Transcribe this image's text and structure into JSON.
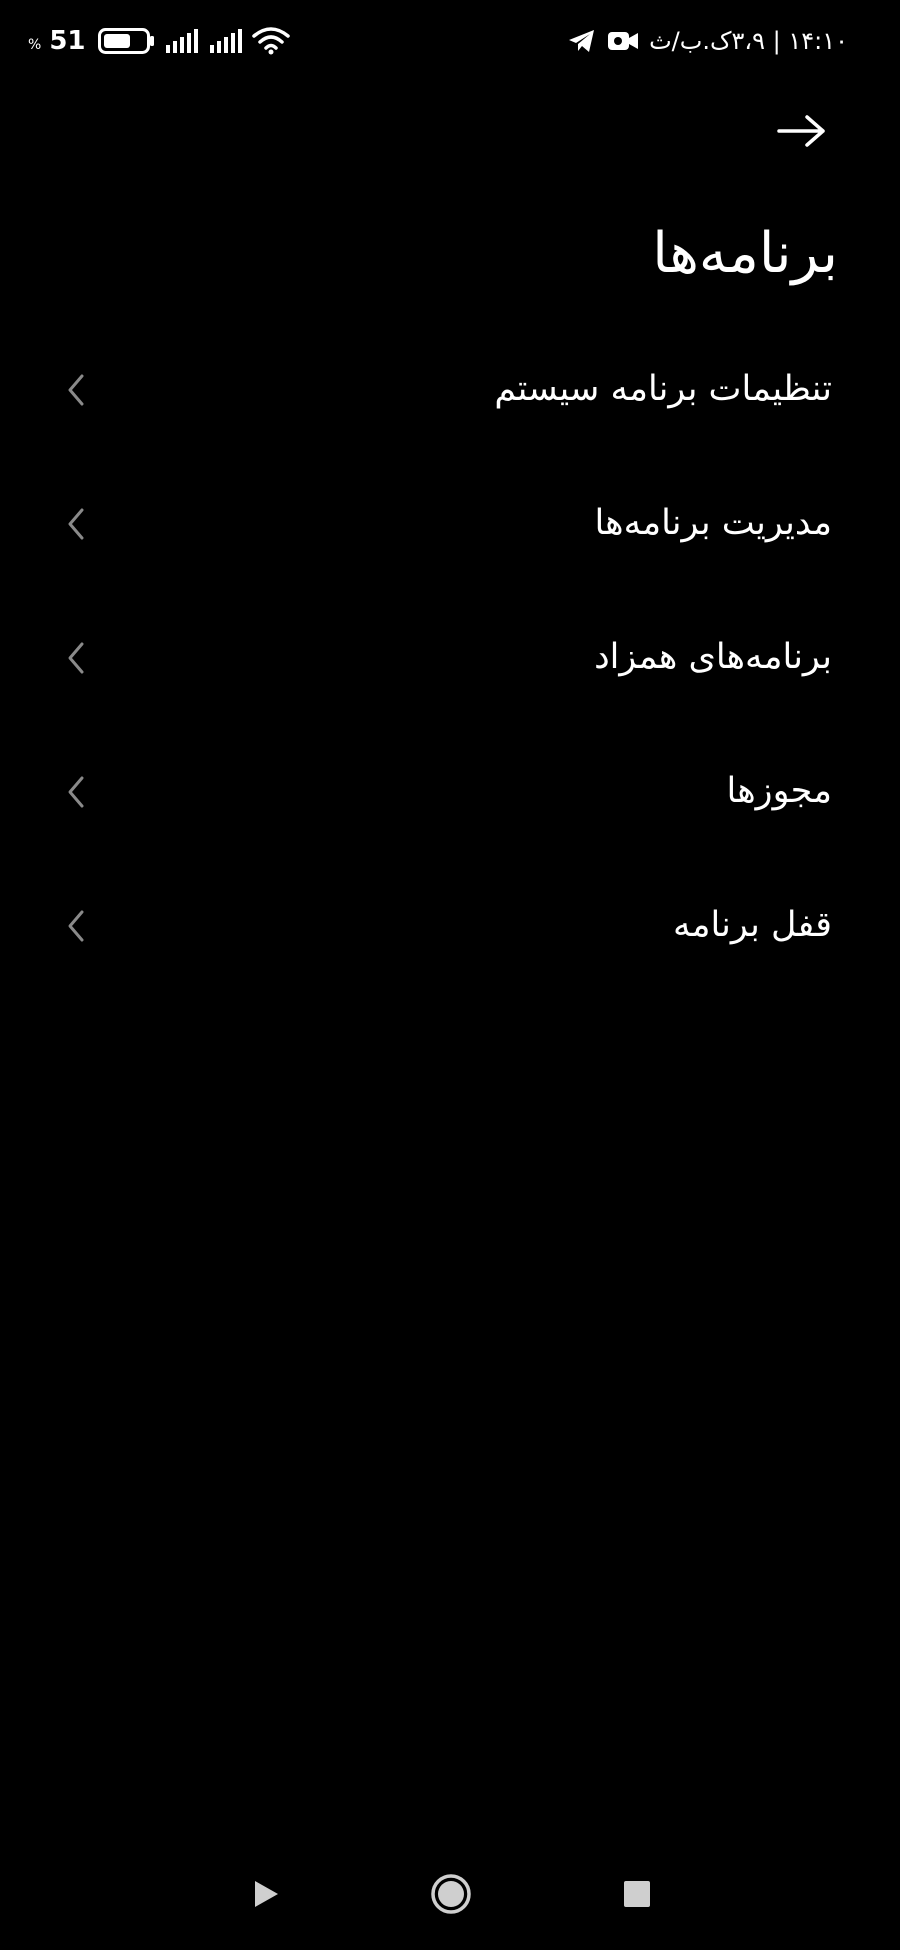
{
  "status_bar": {
    "battery_percent_sign": "%",
    "battery_level": "51",
    "time_text": "۱۴:۱۰ | ۳،۹ک.ب/ث",
    "icons": [
      "battery-icon",
      "signal-icon",
      "signal-icon",
      "wifi-icon",
      "telegram-icon",
      "video-camera-icon"
    ]
  },
  "header": {
    "back_icon": "arrow-right-icon",
    "title": "برنامه‌ها"
  },
  "menu": {
    "items": [
      {
        "label": "تنظیمات برنامه سیستم",
        "icon": "chevron-left-icon"
      },
      {
        "label": "مدیریت برنامه‌ها",
        "icon": "chevron-left-icon"
      },
      {
        "label": "برنامه‌های همزاد",
        "icon": "chevron-left-icon"
      },
      {
        "label": "مجوزها",
        "icon": "chevron-left-icon"
      },
      {
        "label": "قفل برنامه",
        "icon": "chevron-left-icon"
      }
    ]
  },
  "nav_bar": {
    "icons": [
      "back-triangle-icon",
      "home-circle-icon",
      "recents-square-icon"
    ]
  },
  "colors": {
    "background": "#000000",
    "text": "#ffffff",
    "chevron": "#8a8a8a",
    "nav_icon": "#cfcfcf"
  }
}
